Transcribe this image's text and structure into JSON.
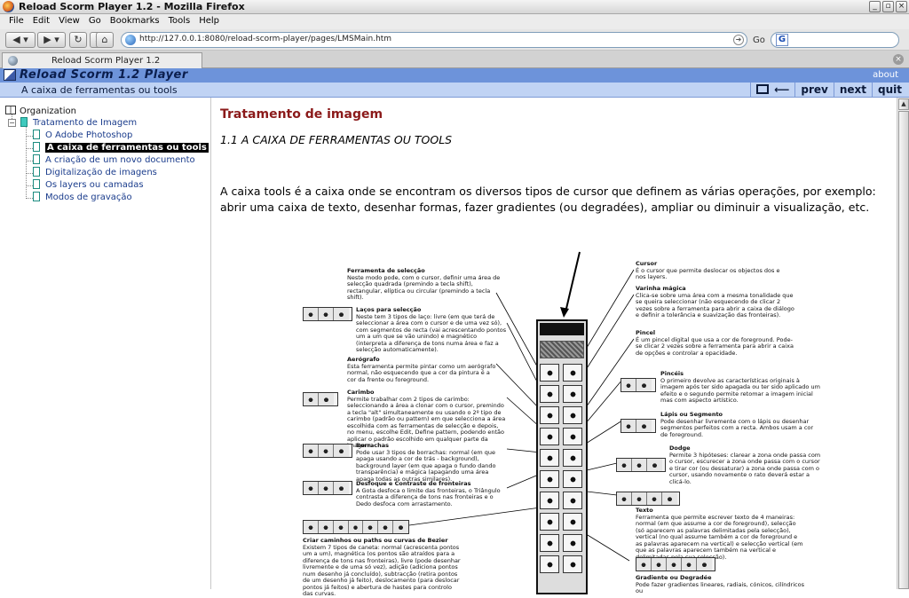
{
  "window": {
    "title": "Reload Scorm Player 1.2 - Mozilla Firefox",
    "controls": [
      "_",
      "▫",
      "×"
    ]
  },
  "menubar": [
    "File",
    "Edit",
    "View",
    "Go",
    "Bookmarks",
    "Tools",
    "Help"
  ],
  "navbar": {
    "url": "http://127.0.0.1:8080/reload-scorm-player/pages/LMSMain.htm",
    "go_label": "Go",
    "search_engine_glyph": "G"
  },
  "tab": {
    "label": "Reload Scorm Player 1.2"
  },
  "player": {
    "title": "Reload Scorm 1.2 Player",
    "about": "about",
    "page_title": "A caixa de ferramentas ou tools",
    "nav": {
      "back_glyph": "⟵",
      "prev": "prev",
      "next": "next",
      "quit": "quit"
    }
  },
  "tree": {
    "root": "Organization",
    "folder": "Tratamento de Imagem",
    "items": [
      "O Adobe Photoshop",
      "A caixa de ferramentas ou tools",
      "A criação de um novo documento",
      "Digitalização de imagens",
      "Os layers ou camadas",
      "Modos de gravação"
    ],
    "selected_index": 1
  },
  "content": {
    "heading": "Tratamento de imagem",
    "subheading": "1.1 A CAIXA DE FERRAMENTAS OU TOOLS",
    "paragraph": "A caixa tools é a caixa onde se encontram os diversos tipos de cursor que definem as várias operações, por exemplo: abrir uma caixa de texto, desenhar formas, fazer gradientes (ou degradées), ampliar ou diminuir a visualização, etc."
  },
  "figure": {
    "left_annotations": [
      {
        "title": "Ferramenta de selecção",
        "text": "Neste modo pode, com o cursor, definir uma área de selecção quadrada (premindo a tecla shift), rectangular, elíptica ou circular (premindo a tecla shift)."
      },
      {
        "title": "Laços para selecção",
        "text": "Neste tem 3 tipos de laço: livre (em que terá de seleccionar a área com o cursor e de uma vez só), com segmentos de recta (vai acrescentando pontos um a um que se vão unindo) e magnético (interpreta a diferença de tons numa área e faz a selecção automaticamente)."
      },
      {
        "title": "Aerógrafo",
        "text": "Esta ferramenta permite pintar como um aerógrafo normal, não esquecendo que a cor da pintura é a cor da frente ou foreground."
      },
      {
        "title": "Carimbo",
        "text": "Permite trabalhar com 2 tipos de carimbo: seleccionando a área a clonar com o cursor, premindo a tecla \"alt\" simultaneamente ou usando o 2º tipo de carimbo (padrão ou pattern) em que selecciona a área escolhida com as ferramentas de selecção e depois, no menu, escolhe Edit, Define pattern, podendo então aplicar o padrão escolhido em qualquer parte da imagem."
      },
      {
        "title": "Borrachas",
        "text": "Pode usar 3 tipos de borrachas: normal (em que apaga usando a cor de trás - background), background layer (em que apaga o fundo dando transparência) e mágica (apagando uma área apaga todas as outras similares)."
      },
      {
        "title": "Desfoque e Contraste de fronteiras",
        "text": "A Gota desfoca o limite das fronteiras, o Triângulo contrasta a diferença de tons nas fronteiras e o Dedo desfoca com arrastamento."
      },
      {
        "title": "Criar caminhos ou paths ou curvas de Bezier",
        "text": "Existem 7 tipos de caneta: normal (acrescenta pontos um a um), magnética (os pontos são atraídos para a diferença de tons nas fronteiras), livre (pode desenhar livremente e de uma só vez), adição (adiciona pontos num desenho já concluído), subtracção (retira pontos de um desenho já feito), deslocamento (para deslocar pontos já feitos) e abertura de hastes para controlo das curvas."
      }
    ],
    "right_annotations": [
      {
        "title": "Cursor",
        "text": "É o cursor que permite deslocar os objectos dos e nos layers."
      },
      {
        "title": "Varinha mágica",
        "text": "Clica-se sobre uma área com a mesma tonalidade que se queira seleccionar (não esquecendo de clicar 2 vezes sobre a ferramenta para abrir a caixa de diálogo e definir a tolerância e suavização das fronteiras)."
      },
      {
        "title": "Pincel",
        "text": "É um pincel digital que usa a cor de foreground. Pode-se clicar 2 vezes sobre a ferramenta para abrir a caixa de opções e controlar a opacidade."
      },
      {
        "title": "Pincéis",
        "text": "O primeiro devolve as características originais à imagem após ter sido apagada ou ter sido aplicado um efeito e o segundo permite retomar a imagem inicial mas com aspecto artístico."
      },
      {
        "title": "Lápis ou Segmento",
        "text": "Pode desenhar livremente com o lápis ou desenhar segmentos perfeitos com a recta. Ambos usam a cor de foreground."
      },
      {
        "title": "Dodge",
        "text": "Permite 3 hipóteses: clarear a zona onde passa com o cursor, escurecer a zona onde passa com o cursor e tirar cor (ou dessaturar) a zona onde passa com o cursor, usando novamente o rato deverá estar a clicá-lo."
      },
      {
        "title": "Texto",
        "text": "Ferramenta que permite escrever texto de 4 maneiras: normal (em que assume a cor de foreground), selecção (só aparecem as palavras delimitadas pela selecção), vertical (no qual assume também a cor de foreground e as palavras aparecem na vertical) e selecção vertical (em que as palavras aparecem também na vertical e delimitadas pela sua selecção)."
      },
      {
        "title": "Gradiente ou Degradée",
        "text": "Pode fazer gradientes lineares, radiais, cónicos, cilíndricos ou"
      }
    ]
  },
  "colors": {
    "reload_bar": "#6d93da",
    "sub_bar": "#c0d3f4",
    "heading": "#8b1a1a",
    "tree_link": "#1a3c8c"
  }
}
